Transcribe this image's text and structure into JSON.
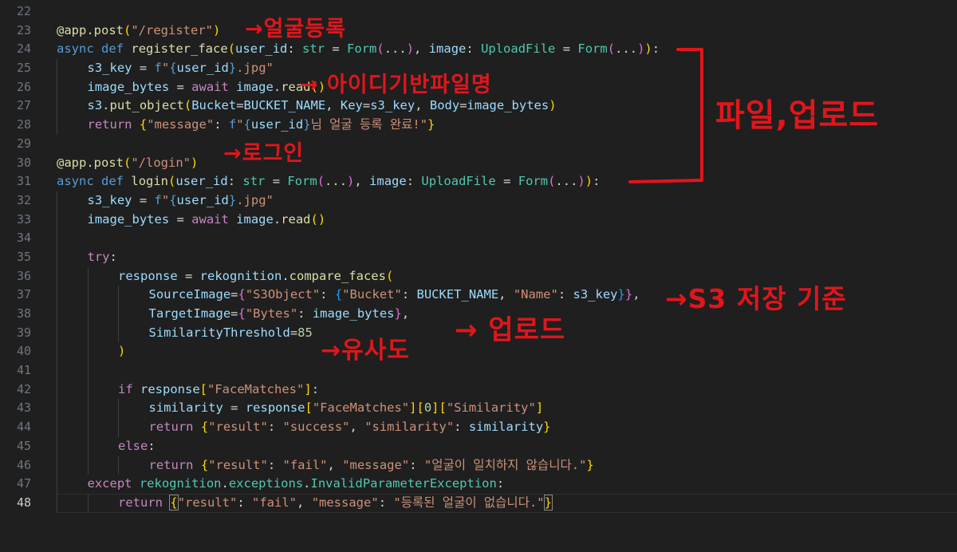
{
  "editor": {
    "lines": [
      {
        "n": "22",
        "active": false,
        "indent": 0,
        "html": ""
      },
      {
        "n": "23",
        "active": false,
        "indent": 0,
        "html": "<span class='f'>@app.post</span><span class='by'>(</span><span class='s'>\"/register\"</span><span class='by'>)</span>"
      },
      {
        "n": "24",
        "active": false,
        "indent": 0,
        "html": "<span class='k'>async</span> <span class='k'>def</span> <span class='f'>register_face</span><span class='by'>(</span><span class='v'>user_id</span>: <span class='t'>str</span> = <span class='t'>Form</span><span class='bp'>(</span>...<span class='bp'>)</span>, <span class='v'>image</span>: <span class='t'>UploadFile</span> = <span class='t'>Form</span><span class='bp'>(</span>...<span class='bp'>)</span><span class='by'>)</span>:"
      },
      {
        "n": "25",
        "active": false,
        "indent": 1,
        "html": "<span class='v'>s3_key</span> = <span class='k'>f</span><span class='s'>\"</span><span class='k'>{</span><span class='v'>user_id</span><span class='k'>}</span><span class='s'>.jpg\"</span>"
      },
      {
        "n": "26",
        "active": false,
        "indent": 1,
        "html": "<span class='v'>image_bytes</span> = <span class='c'>await</span> <span class='v'>image</span>.<span class='f'>read</span><span class='by'>()</span>"
      },
      {
        "n": "27",
        "active": false,
        "indent": 1,
        "html": "<span class='v'>s3</span>.<span class='f'>put_object</span><span class='by'>(</span><span class='v'>Bucket</span>=<span class='v'>BUCKET_NAME</span>, <span class='v'>Key</span>=<span class='v'>s3_key</span>, <span class='v'>Body</span>=<span class='v'>image_bytes</span><span class='by'>)</span>"
      },
      {
        "n": "28",
        "active": false,
        "indent": 1,
        "html": "<span class='c'>return</span> <span class='by'>{</span><span class='s'>\"message\"</span>: <span class='k'>f</span><span class='s'>\"</span><span class='k'>{</span><span class='v'>user_id</span><span class='k'>}</span><span class='s'>님 얼굴 등록 완료!\"</span><span class='by'>}</span>"
      },
      {
        "n": "29",
        "active": false,
        "indent": 0,
        "html": ""
      },
      {
        "n": "30",
        "active": false,
        "indent": 0,
        "html": "<span class='f'>@app.post</span><span class='by'>(</span><span class='s'>\"/login\"</span><span class='by'>)</span>"
      },
      {
        "n": "31",
        "active": false,
        "indent": 0,
        "html": "<span class='k'>async</span> <span class='k'>def</span> <span class='f'>login</span><span class='by'>(</span><span class='v'>user_id</span>: <span class='t'>str</span> = <span class='t'>Form</span><span class='bp'>(</span>...<span class='bp'>)</span>, <span class='v'>image</span>: <span class='t'>UploadFile</span> = <span class='t'>Form</span><span class='bp'>(</span>...<span class='bp'>)</span><span class='by'>)</span>:"
      },
      {
        "n": "32",
        "active": false,
        "indent": 1,
        "html": "<span class='v'>s3_key</span> = <span class='k'>f</span><span class='s'>\"</span><span class='k'>{</span><span class='v'>user_id</span><span class='k'>}</span><span class='s'>.jpg\"</span>"
      },
      {
        "n": "33",
        "active": false,
        "indent": 1,
        "html": "<span class='v'>image_bytes</span> = <span class='c'>await</span> <span class='v'>image</span>.<span class='f'>read</span><span class='by'>()</span>"
      },
      {
        "n": "34",
        "active": false,
        "indent": 1,
        "html": ""
      },
      {
        "n": "35",
        "active": false,
        "indent": 1,
        "html": "<span class='c'>try</span>:"
      },
      {
        "n": "36",
        "active": false,
        "indent": 2,
        "html": "<span class='v'>response</span> = <span class='v'>rekognition</span>.<span class='f'>compare_faces</span><span class='by'>(</span>"
      },
      {
        "n": "37",
        "active": false,
        "indent": 3,
        "html": "<span class='v'>SourceImage</span>=<span class='bp'>{</span><span class='s'>\"S3Object\"</span>: <span class='bb'>{</span><span class='s'>\"Bucket\"</span>: <span class='v'>BUCKET_NAME</span>, <span class='s'>\"Name\"</span>: <span class='v'>s3_key</span><span class='bb'>}</span><span class='bp'>}</span>,"
      },
      {
        "n": "38",
        "active": false,
        "indent": 3,
        "html": "<span class='v'>TargetImage</span>=<span class='bp'>{</span><span class='s'>\"Bytes\"</span>: <span class='v'>image_bytes</span><span class='bp'>}</span>,"
      },
      {
        "n": "39",
        "active": false,
        "indent": 3,
        "html": "<span class='v'>SimilarityThreshold</span>=<span class='n'>85</span>"
      },
      {
        "n": "40",
        "active": false,
        "indent": 2,
        "html": "<span class='by'>)</span>"
      },
      {
        "n": "41",
        "active": false,
        "indent": 2,
        "html": ""
      },
      {
        "n": "42",
        "active": false,
        "indent": 2,
        "html": "<span class='c'>if</span> <span class='v'>response</span><span class='by'>[</span><span class='s'>\"FaceMatches\"</span><span class='by'>]</span>:"
      },
      {
        "n": "43",
        "active": false,
        "indent": 3,
        "html": "<span class='v'>similarity</span> = <span class='v'>response</span><span class='by'>[</span><span class='s'>\"FaceMatches\"</span><span class='by'>][</span><span class='n'>0</span><span class='by'>][</span><span class='s'>\"Similarity\"</span><span class='by'>]</span>"
      },
      {
        "n": "44",
        "active": false,
        "indent": 3,
        "html": "<span class='c'>return</span> <span class='by'>{</span><span class='s'>\"result\"</span>: <span class='s'>\"success\"</span>, <span class='s'>\"similarity\"</span>: <span class='v'>similarity</span><span class='by'>}</span>"
      },
      {
        "n": "45",
        "active": false,
        "indent": 2,
        "html": "<span class='c'>else</span>:"
      },
      {
        "n": "46",
        "active": false,
        "indent": 3,
        "html": "<span class='c'>return</span> <span class='by'>{</span><span class='s'>\"result\"</span>: <span class='s'>\"fail\"</span>, <span class='s'>\"message\"</span>: <span class='s'>\"얼굴이 일치하지 않습니다.\"</span><span class='by'>}</span>"
      },
      {
        "n": "47",
        "active": false,
        "indent": 1,
        "html": "<span class='c'>except</span> <span class='t'>rekognition</span>.<span class='t'>exceptions</span>.<span class='t'>InvalidParameterException</span>:"
      },
      {
        "n": "48",
        "active": true,
        "indent": 2,
        "html": "<span class='c'>return</span> <span class='by bracket-match'>{</span><span class='s'>\"result\"</span>: <span class='s'>\"fail\"</span>, <span class='s'>\"message\"</span>: <span class='s'>\"등록된 얼굴이 없습니다.\"</span><span class='by bracket-match'>}</span>"
      }
    ]
  },
  "annotations": {
    "register": "→얼굴등록",
    "filename": "→ 아이디기반파일명",
    "upload_file": "파일,업로드",
    "login": "→로그인",
    "s3_basis": "→S3 저장 기준",
    "upload": "→ 업로드",
    "similarity": "→유사도"
  },
  "colors": {
    "annotation": "#e0161b",
    "background": "#1f1f1f"
  }
}
